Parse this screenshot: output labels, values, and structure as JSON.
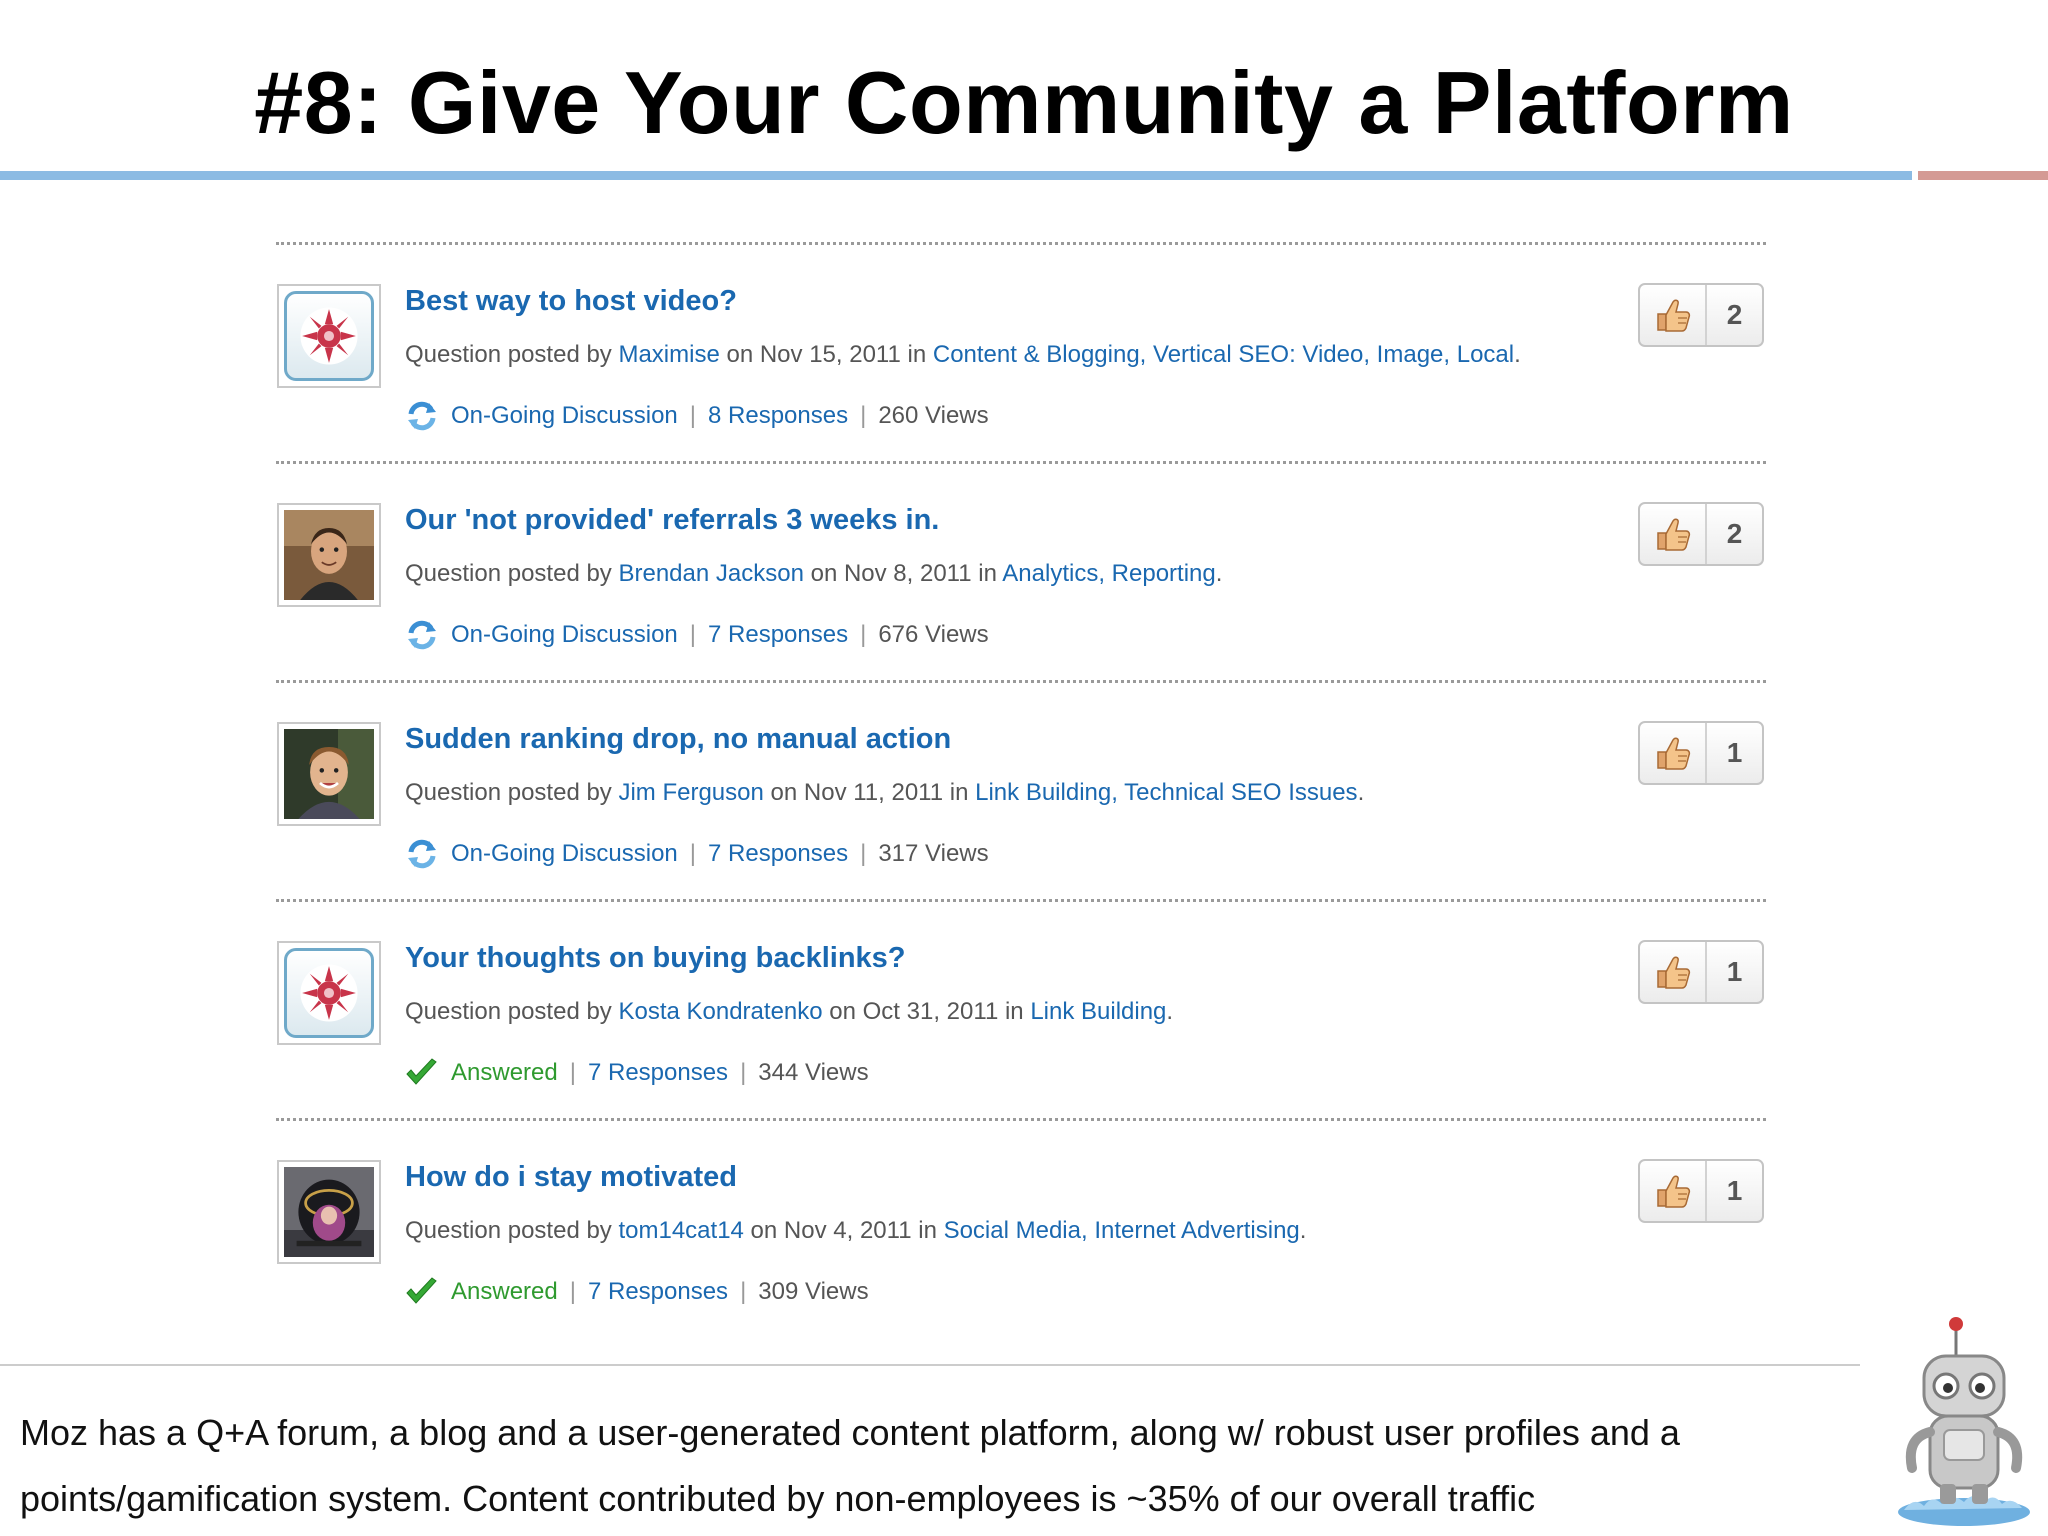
{
  "slide": {
    "title": "#8: Give Your Community a Platform",
    "caption_line1": "Moz has a Q+A forum, a blog and a user-generated content platform, along w/ robust user profiles and a",
    "caption_line2": "points/gamification system. Content contributed by non-employees is ~35% of our overall traffic"
  },
  "colors": {
    "link": "#1a68b0",
    "answered": "#2f9a2f",
    "title_rule_blue": "#8cbbe3",
    "title_rule_red": "#d49a94"
  },
  "questions": [
    {
      "title": "Best way to host video?",
      "prefix": "Question posted by ",
      "author": "Maximise",
      "date_text": " on Nov 15, 2011 in ",
      "categories": "Content & Blogging, Vertical SEO: Video, Image, Local",
      "end": ".",
      "status": "On-Going Discussion",
      "status_icon": "ongoing-discussion-icon",
      "responses": "8 Responses",
      "views": "260 Views",
      "votes": "2",
      "avatar": "default"
    },
    {
      "title": "Our 'not provided' referrals 3 weeks in.",
      "prefix": "Question posted by ",
      "author": "Brendan Jackson",
      "date_text": " on Nov 8, 2011 in ",
      "categories": "Analytics, Reporting",
      "end": ".",
      "status": "On-Going Discussion",
      "status_icon": "ongoing-discussion-icon",
      "responses": "7 Responses",
      "views": "676 Views",
      "votes": "2",
      "avatar": "photo"
    },
    {
      "title": "Sudden ranking drop, no manual action",
      "prefix": "Question posted by ",
      "author": "Jim Ferguson",
      "date_text": " on Nov 11, 2011 in ",
      "categories": "Link Building, Technical SEO Issues",
      "end": ".",
      "status": "On-Going Discussion",
      "status_icon": "ongoing-discussion-icon",
      "responses": "7 Responses",
      "views": "317 Views",
      "votes": "1",
      "avatar": "photo"
    },
    {
      "title": "Your thoughts on buying backlinks?",
      "prefix": "Question posted by ",
      "author": "Kosta Kondratenko",
      "date_text": " on Oct 31, 2011 in ",
      "categories": "Link Building",
      "end": ".",
      "status": "Answered",
      "status_icon": "checkmark-icon",
      "responses": "7 Responses",
      "views": "344 Views",
      "votes": "1",
      "avatar": "default"
    },
    {
      "title": "How do i stay motivated",
      "prefix": "Question posted by ",
      "author": "tom14cat14",
      "date_text": " on Nov 4, 2011 in ",
      "categories": "Social Media, Internet Advertising",
      "end": ".",
      "status": "Answered",
      "status_icon": "checkmark-icon",
      "responses": "7 Responses",
      "views": "309 Views",
      "votes": "1",
      "avatar": "photo"
    }
  ]
}
